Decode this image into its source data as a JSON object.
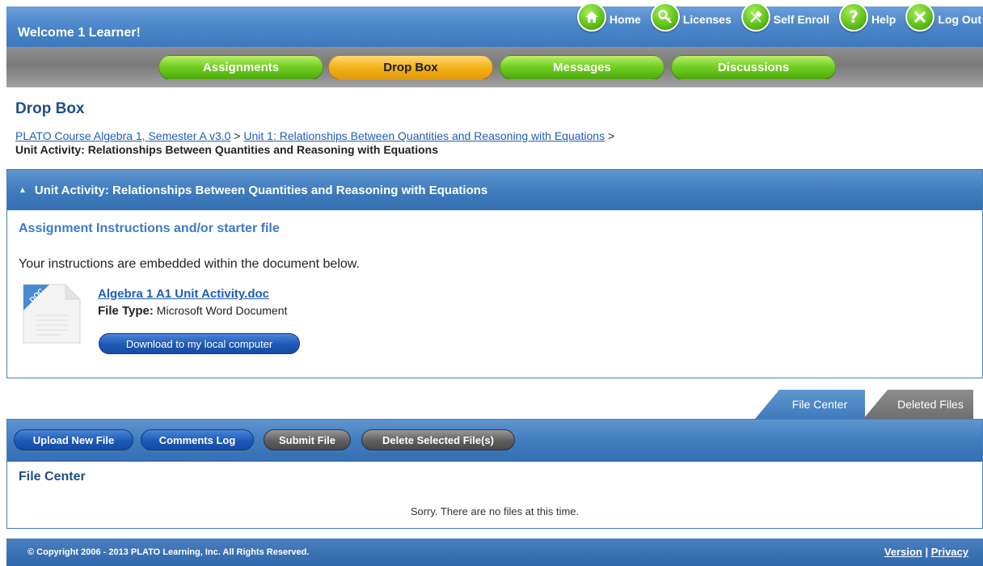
{
  "header": {
    "welcome": "Welcome 1 Learner!",
    "nav": [
      {
        "label": "Home",
        "icon": "home-icon"
      },
      {
        "label": "Licenses",
        "icon": "key-icon"
      },
      {
        "label": "Self Enroll",
        "icon": "wrench-icon"
      },
      {
        "label": "Help",
        "icon": "question-icon"
      },
      {
        "label": "Log Out",
        "icon": "close-icon"
      }
    ]
  },
  "tabs": [
    {
      "label": "Assignments",
      "color": "#6ecc1e"
    },
    {
      "label": "Drop Box",
      "color": "#f2b21a",
      "active": true
    },
    {
      "label": "Messages",
      "color": "#6ecc1e"
    },
    {
      "label": "Discussions",
      "color": "#6ecc1e"
    }
  ],
  "page": {
    "title": "Drop Box",
    "breadcrumb": {
      "course": "PLATO Course Algebra 1, Semester A v3.0",
      "sep1": " > ",
      "unit": "Unit 1: Relationships Between Quantities and Reasoning with Equations",
      "sep2": " >",
      "current": "Unit Activity: Relationships Between Quantities and Reasoning with Equations"
    }
  },
  "activity": {
    "header": "Unit Activity: Relationships Between Quantities and Reasoning with Equations",
    "sub_heading": "Assignment Instructions and/or starter file",
    "instructions": "Your instructions are embedded within the document below.",
    "file_name": "Algebra 1 A1 Unit Activity.doc",
    "file_type_label": "File Type:",
    "file_type": "Microsoft Word Document",
    "doc_icon_text": "DOC",
    "download_label": "Download to my local computer"
  },
  "file_tabs": [
    {
      "label": "File Center",
      "active": true
    },
    {
      "label": "Deleted Files",
      "active": false
    }
  ],
  "file_center": {
    "buttons": [
      {
        "label": "Upload New File",
        "style": "blue"
      },
      {
        "label": "Comments Log",
        "style": "blue"
      },
      {
        "label": "Submit File",
        "style": "gray"
      },
      {
        "label": "Delete Selected File(s)",
        "style": "gray"
      }
    ],
    "heading": "File Center",
    "empty_message": "Sorry. There are no files at this time."
  },
  "footer": {
    "copyright": "© Copyright 2006 - 2013 PLATO Learning, Inc. All Rights Reserved.",
    "version": "Version",
    "separator": "|",
    "privacy": "Privacy"
  },
  "colors": {
    "header_blue": "#4a86c8",
    "tab_green": "#6ecc1e",
    "tab_orange": "#f2b21a",
    "link_blue": "#1f5db8",
    "title_blue": "#1d4f86"
  }
}
